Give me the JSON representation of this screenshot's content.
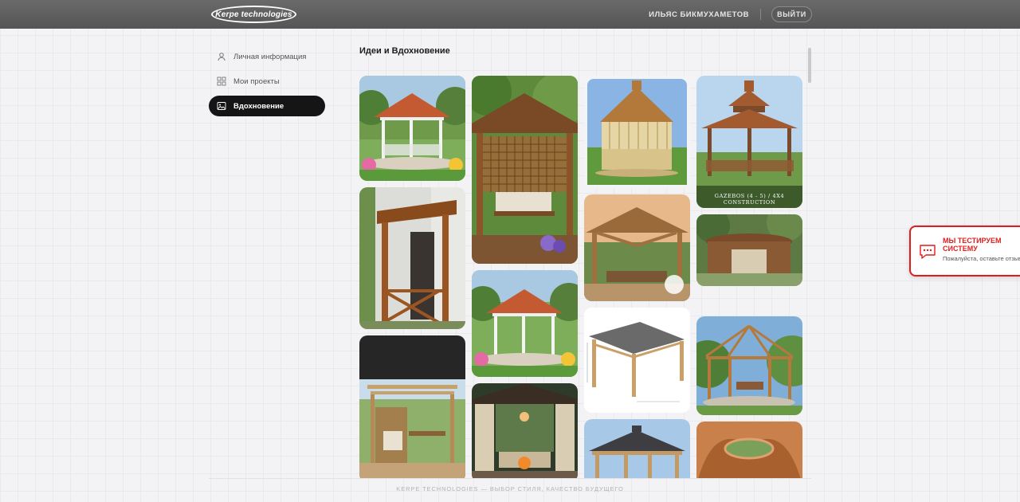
{
  "header": {
    "logo_text": "Kerpe technologies",
    "user_name": "ИЛЬЯС БИКМУХАМЕТОВ",
    "logout_label": "ВЫЙТИ"
  },
  "sidebar": {
    "items": [
      {
        "label": "Личная информация",
        "icon": "user-icon",
        "active": false
      },
      {
        "label": "Мои проекты",
        "icon": "grid-icon",
        "active": false
      },
      {
        "label": "Вдохновение",
        "icon": "image-icon",
        "active": true
      }
    ]
  },
  "main": {
    "title": "Идеи и Вдохновение",
    "gallery": {
      "columns": 4,
      "cards": [
        {
          "subject": "white-gazebo-terracotta-roof",
          "caption": ""
        },
        {
          "subject": "wooden-porch-canopy",
          "caption": ""
        },
        {
          "subject": "pergola-lounge-dark",
          "caption": ""
        },
        {
          "subject": "wooden-lattice-gazebo-swing",
          "caption": ""
        },
        {
          "subject": "white-gazebo-terracotta-roof-alt",
          "caption": ""
        },
        {
          "subject": "gazebo-curtains-firepit",
          "caption": ""
        },
        {
          "subject": "octagon-cedar-gazebo",
          "caption": ""
        },
        {
          "subject": "timber-pavilion-sunset",
          "caption": ""
        },
        {
          "subject": "pavilion-drawing-dimensions",
          "caption": ""
        },
        {
          "subject": "dark-roof-pavilion",
          "caption": ""
        },
        {
          "subject": "two-tier-roof-gazebo",
          "caption": "GAZEBOS (4 - 5) / 4X4 CONSTRUCTION"
        },
        {
          "subject": "round-timber-pavilion",
          "caption": ""
        },
        {
          "subject": "open-frame-gazebo-garden",
          "caption": ""
        },
        {
          "subject": "curved-wood-dome",
          "caption": ""
        }
      ]
    }
  },
  "feedback": {
    "title": "МЫ ТЕСТИРУЕМ СИСТЕМУ",
    "subtitle": "Пожалуйста, оставьте отзыв",
    "accent_color": "#e11c1c"
  },
  "footer": {
    "text": "KERPE TECHNOLOGIES — ВЫБОР СТИЛЯ, КАЧЕСТВО БУДУЩЕГО"
  },
  "colors": {
    "header_bg": "#5e5e5e",
    "active_nav_bg": "#151515",
    "page_bg": "#f3f3f5"
  }
}
